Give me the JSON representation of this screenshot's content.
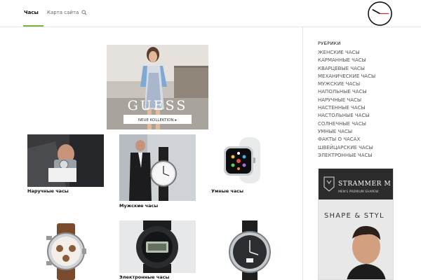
{
  "nav": {
    "items": [
      {
        "label": "Часы",
        "active": true
      },
      {
        "label": "Карта сайта",
        "active": false
      }
    ],
    "search_icon": "search-icon",
    "accent": "#7fb03a"
  },
  "logo": {
    "icon": "clock-icon"
  },
  "ad_guess": {
    "brand": "GUESS",
    "cta": "NEUE KOLLEKTION  ▸"
  },
  "products": [
    {
      "label": "Наручные часы"
    },
    {
      "label": "Мужские часы"
    },
    {
      "label": "Умные часы"
    },
    {
      "label": ""
    },
    {
      "label": "Электронные часы"
    },
    {
      "label": ""
    }
  ],
  "sidebar": {
    "title": "РУБРИКИ",
    "categories": [
      "ЖЕНСКИЕ ЧАСЫ",
      "КАРМАННЫЕ ЧАСЫ",
      "КВАРЦЕВЫЕ ЧАСЫ",
      "МЕХАНИЧЕСКИЕ ЧАСЫ",
      "МУЖСКИЕ ЧАСЫ",
      "НАПОЛЬНЫЕ ЧАСЫ",
      "НАРУЧНЫЕ ЧАСЫ",
      "НАСТЕННЫЕ ЧАСЫ",
      "НАСТОЛЬНЫЕ ЧАСЫ",
      "СОЛНЕЧНЫЕ ЧАСЫ",
      "УМНЫЕ ЧАСЫ",
      "ФАКТЫ О ЧАСАХ",
      "ШВЕЙЦАРСКИЕ ЧАСЫ",
      "ЭЛЕКТРОННЫЕ ЧАСЫ"
    ]
  },
  "ad_strammer": {
    "brand": "STRAMMER M",
    "tagline": "MEN'S PREMIUM SHAPEW",
    "headline": "SHAPE & STYL"
  }
}
